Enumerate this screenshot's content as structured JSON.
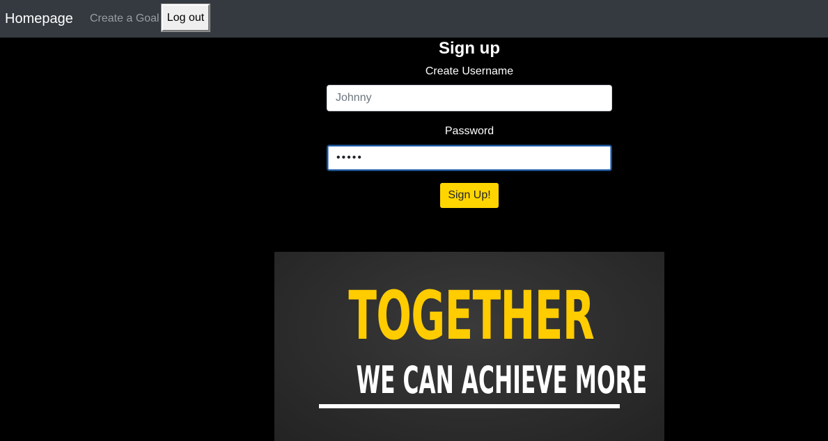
{
  "navbar": {
    "brand": "Homepage",
    "links": [
      {
        "label": "Create a Goal"
      }
    ],
    "logout_label": "Log out"
  },
  "form": {
    "title": "Sign up",
    "username_label": "Create Username",
    "username_placeholder": "Johnny",
    "username_value": "",
    "password_label": "Password",
    "password_value": "•••••",
    "submit_label": "Sign Up!"
  },
  "poster": {
    "headline": "TOGETHER",
    "subline": "WE CAN ACHIEVE MORE"
  },
  "colors": {
    "navbar_bg": "#343a40",
    "page_bg": "#000000",
    "accent_yellow": "#ffd500",
    "poster_bg": "#2d2d2d"
  }
}
